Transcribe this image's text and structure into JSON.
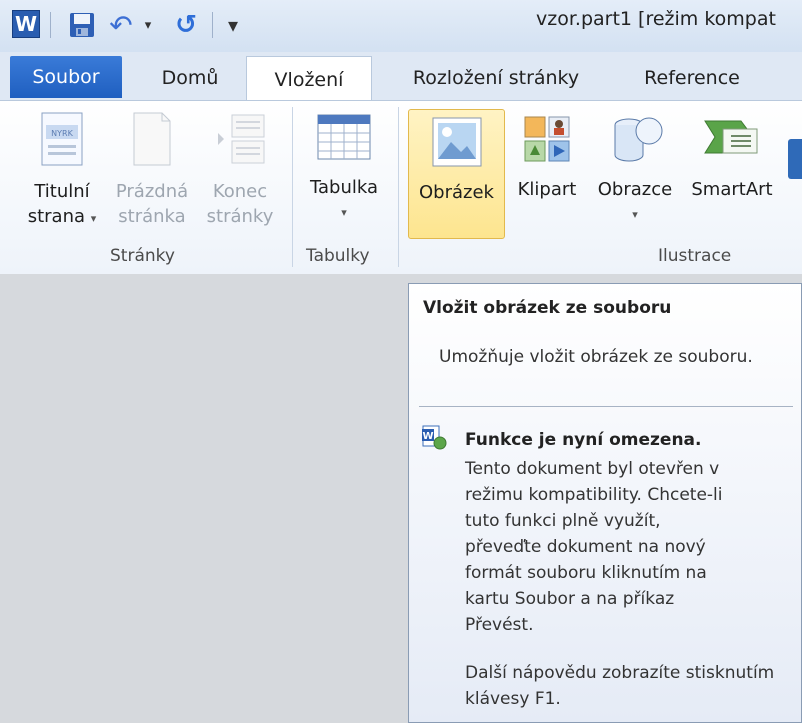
{
  "app": {
    "icon_letter": "W",
    "doc_title": "vzor.part1 [režim kompat"
  },
  "qat": {
    "undo_drop": "▾",
    "customize": "▾"
  },
  "tabs": {
    "file": "Soubor",
    "home": "Domů",
    "insert": "Vložení",
    "layout": "Rozložení stránky",
    "reference": "Reference"
  },
  "ribbon": {
    "pages": {
      "label": "Stránky",
      "title_page": [
        "Titulní",
        "strana"
      ],
      "blank_page": [
        "Prázdná",
        "stránka"
      ],
      "page_break": [
        "Konec",
        "stránky"
      ]
    },
    "tables": {
      "label": "Tabulky",
      "table": "Tabulka"
    },
    "illustrations": {
      "label": "Ilustrace",
      "picture": "Obrázek",
      "clipart": "Klipart",
      "shapes": "Obrazce",
      "smartart": "SmartArt"
    }
  },
  "tooltip": {
    "title": "Vložit obrázek ze souboru",
    "description": "Umožňuje vložit obrázek ze souboru.",
    "warning_title": "Funkce je nyní omezena.",
    "warning_body": "Tento dokument byl otevřen v\nrežimu kompatibility. Chcete-li\ntuto funkci plně využít,\npřeveďte dokument na nový\nformát souboru kliknutím na\nkartu Soubor a na příkaz\nPřevést.",
    "help": "Další nápovědu zobrazíte stisknutím klávesy F1."
  }
}
